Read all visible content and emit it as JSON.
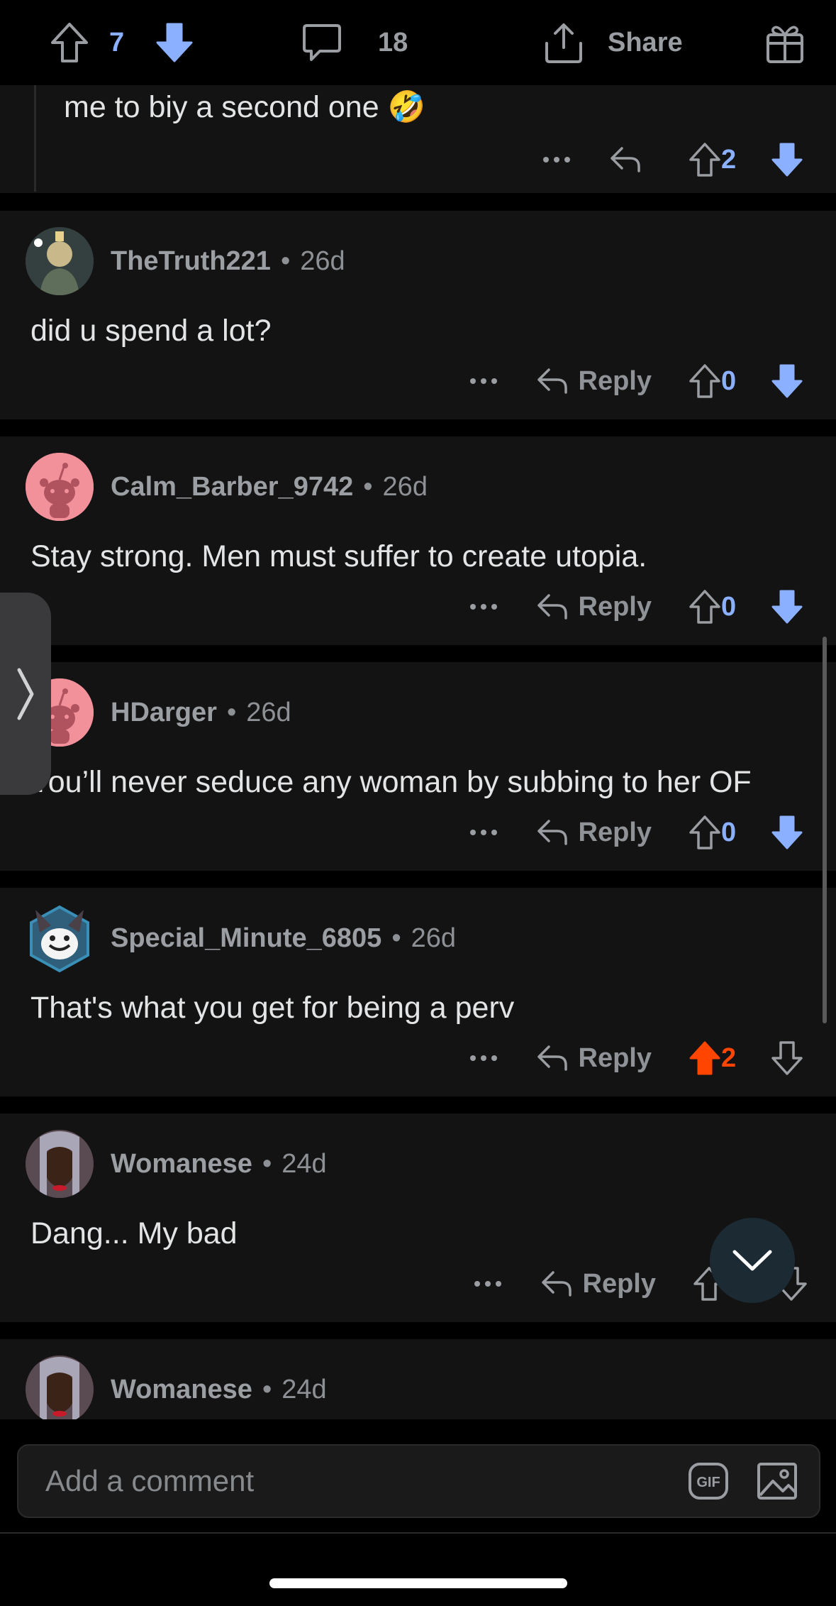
{
  "post_bar": {
    "upvote_count": "7",
    "comment_count": "18",
    "share_label": "Share"
  },
  "comments": [
    {
      "text": "me to biy a second one 🤣",
      "score": "2"
    },
    {
      "username": "TheTruth221",
      "age": "26d",
      "text": "did u spend a lot?",
      "reply_label": "Reply",
      "score": "0"
    },
    {
      "username": "Calm_Barber_9742",
      "age": "26d",
      "text": "Stay strong. Men must suffer to create utopia.",
      "reply_label": "Reply",
      "score": "0"
    },
    {
      "username": "HDarger",
      "age": "26d",
      "text": "You’ll never seduce any woman by subbing to her OF",
      "reply_label": "Reply",
      "score": "0"
    },
    {
      "username": "Special_Minute_6805",
      "age": "26d",
      "text": "That's what you get for being a perv",
      "reply_label": "Reply",
      "score": "2"
    },
    {
      "username": "Womanese",
      "age": "24d",
      "text": "Dang... My bad",
      "reply_label": "Reply"
    },
    {
      "username": "Womanese",
      "age": "24d"
    }
  ],
  "composer": {
    "placeholder": "Add a comment",
    "gif_label": "GIF"
  },
  "colors": {
    "upvote_active": "#ff4500",
    "downvote_active": "#8ab0ff",
    "card_bg": "#131313",
    "page_bg": "#000000"
  }
}
